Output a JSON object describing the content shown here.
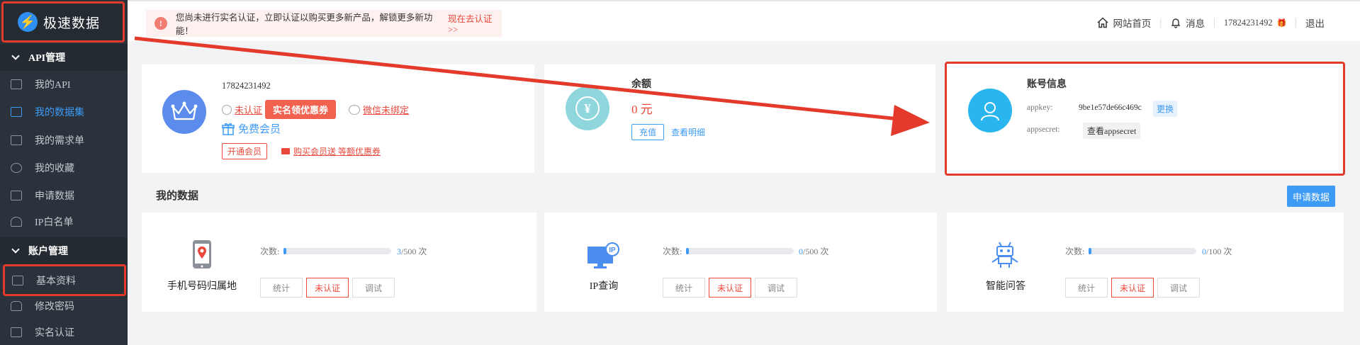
{
  "app": {
    "logo_glyph": "⚡",
    "logo_text": "极速数据"
  },
  "sidebar": {
    "groups": [
      {
        "label": "API管理"
      },
      {
        "label": "账户管理"
      }
    ],
    "api_items": [
      {
        "label": "我的API",
        "icon": "grid-icon"
      },
      {
        "label": "我的数据集",
        "icon": "dataset-icon"
      },
      {
        "label": "我的需求单",
        "icon": "list-icon"
      },
      {
        "label": "我的收藏",
        "icon": "star-icon"
      },
      {
        "label": "申请数据",
        "icon": "document-icon"
      },
      {
        "label": "IP白名单",
        "icon": "user-icon"
      }
    ],
    "account_items": [
      {
        "label": "基本资料",
        "icon": "id-card-icon"
      },
      {
        "label": "修改密码",
        "icon": "lock-icon"
      },
      {
        "label": "实名认证",
        "icon": "user-list-icon"
      }
    ]
  },
  "notice": {
    "icon": "!",
    "text": "您尚未进行实名认证，立即认证以购买更多新产品，解锁更多新功能！",
    "link": "现在去认证>>"
  },
  "topnav": {
    "home": "网站首页",
    "messages": "消息",
    "user": "17824231492",
    "gift": "🎁",
    "logout": "退出"
  },
  "profile_card": {
    "phone": "17824231492",
    "unverified": "未认证",
    "coupon_badge": "实名领优惠券",
    "wechat": "微信未绑定",
    "member": "免费会员",
    "open_member": "开通会员",
    "buy_member": "购买会员送 等额优惠券"
  },
  "balance_card": {
    "title": "余额",
    "amount": "0 元",
    "recharge": "充值",
    "details": "查看明细",
    "coin_glyph": "¥"
  },
  "account_card": {
    "title": "账号信息",
    "appkey_label": "appkey:",
    "appkey_value": "9be1e57de66c469c",
    "change": "更换",
    "appsecret_label": "appsecret:",
    "view_secret": "查看appsecret"
  },
  "my_data": {
    "title": "我的数据",
    "apply_button": "申请数据",
    "count_label": "次数:",
    "actions": [
      "统计",
      "未认证",
      "调试"
    ],
    "items": [
      {
        "name": "手机号码归属地",
        "used": "3",
        "total": "/500 次",
        "icon": "phone-location-icon",
        "usage": 0.006
      },
      {
        "name": "IP查询",
        "used": "0",
        "total": "/500 次",
        "icon": "ip-monitor-icon",
        "usage": 0.0
      },
      {
        "name": "智能问答",
        "used": "0",
        "total": "/100 次",
        "icon": "robot-icon",
        "usage": 0.0
      }
    ]
  },
  "colors": {
    "accent": "#3d9bf5",
    "danger": "#e8493c",
    "sidebar": "#2b323b",
    "annotation": "#e43a2b"
  }
}
